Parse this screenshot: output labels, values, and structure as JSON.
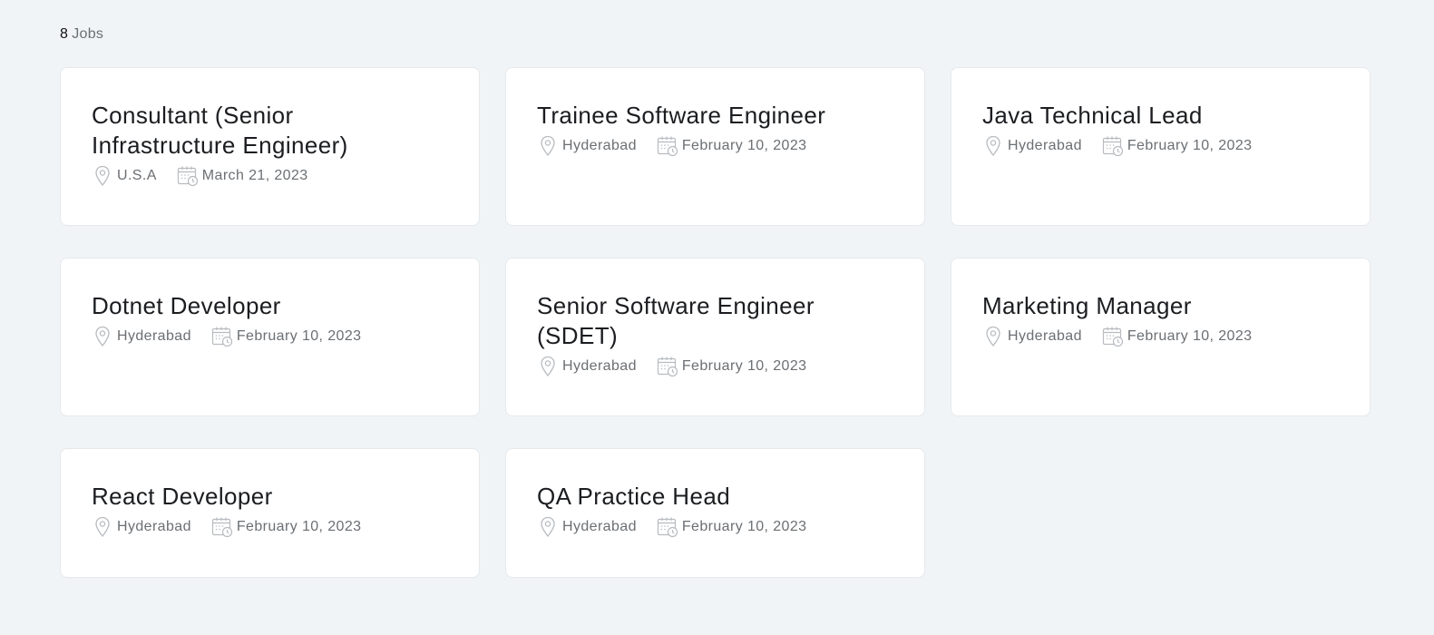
{
  "header": {
    "count": "8",
    "count_label": "Jobs"
  },
  "jobs": [
    {
      "title": "Consultant (Senior Infrastructure Engineer)",
      "location": "U.S.A",
      "date": "March 21, 2023"
    },
    {
      "title": "Trainee Software Engineer",
      "location": "Hyderabad",
      "date": "February 10, 2023"
    },
    {
      "title": "Java Technical Lead",
      "location": "Hyderabad",
      "date": "February 10, 2023"
    },
    {
      "title": "Dotnet Developer",
      "location": "Hyderabad",
      "date": "February 10, 2023"
    },
    {
      "title": "Senior Software Engineer (SDET)",
      "location": "Hyderabad",
      "date": "February 10, 2023"
    },
    {
      "title": "Marketing Manager",
      "location": "Hyderabad",
      "date": "February 10, 2023"
    },
    {
      "title": "React Developer",
      "location": "Hyderabad",
      "date": "February 10, 2023"
    },
    {
      "title": "QA Practice Head",
      "location": "Hyderabad",
      "date": "February 10, 2023"
    }
  ],
  "icons": {
    "location": "location-pin-icon",
    "date": "calendar-clock-icon"
  },
  "colors": {
    "background": "#f0f4f6",
    "card": "#ffffff",
    "title": "#1b1d20",
    "meta": "#6b6f73",
    "icon": "#b8bcc0"
  }
}
